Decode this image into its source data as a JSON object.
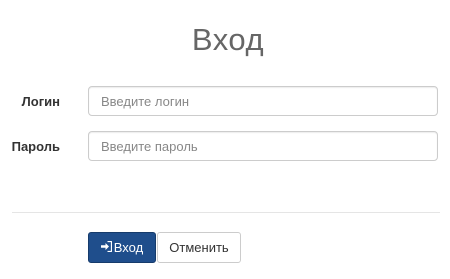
{
  "page": {
    "title": "Вход"
  },
  "form": {
    "login": {
      "label": "Логин",
      "placeholder": "Введите логин",
      "value": ""
    },
    "password": {
      "label": "Пароль",
      "placeholder": "Введите пароль",
      "value": ""
    }
  },
  "actions": {
    "submit_label": "Вход",
    "submit_icon": "sign-in-icon",
    "cancel_label": "Отменить"
  },
  "colors": {
    "primary": "#1f4e8c",
    "title": "#666666",
    "border": "#cccccc"
  }
}
